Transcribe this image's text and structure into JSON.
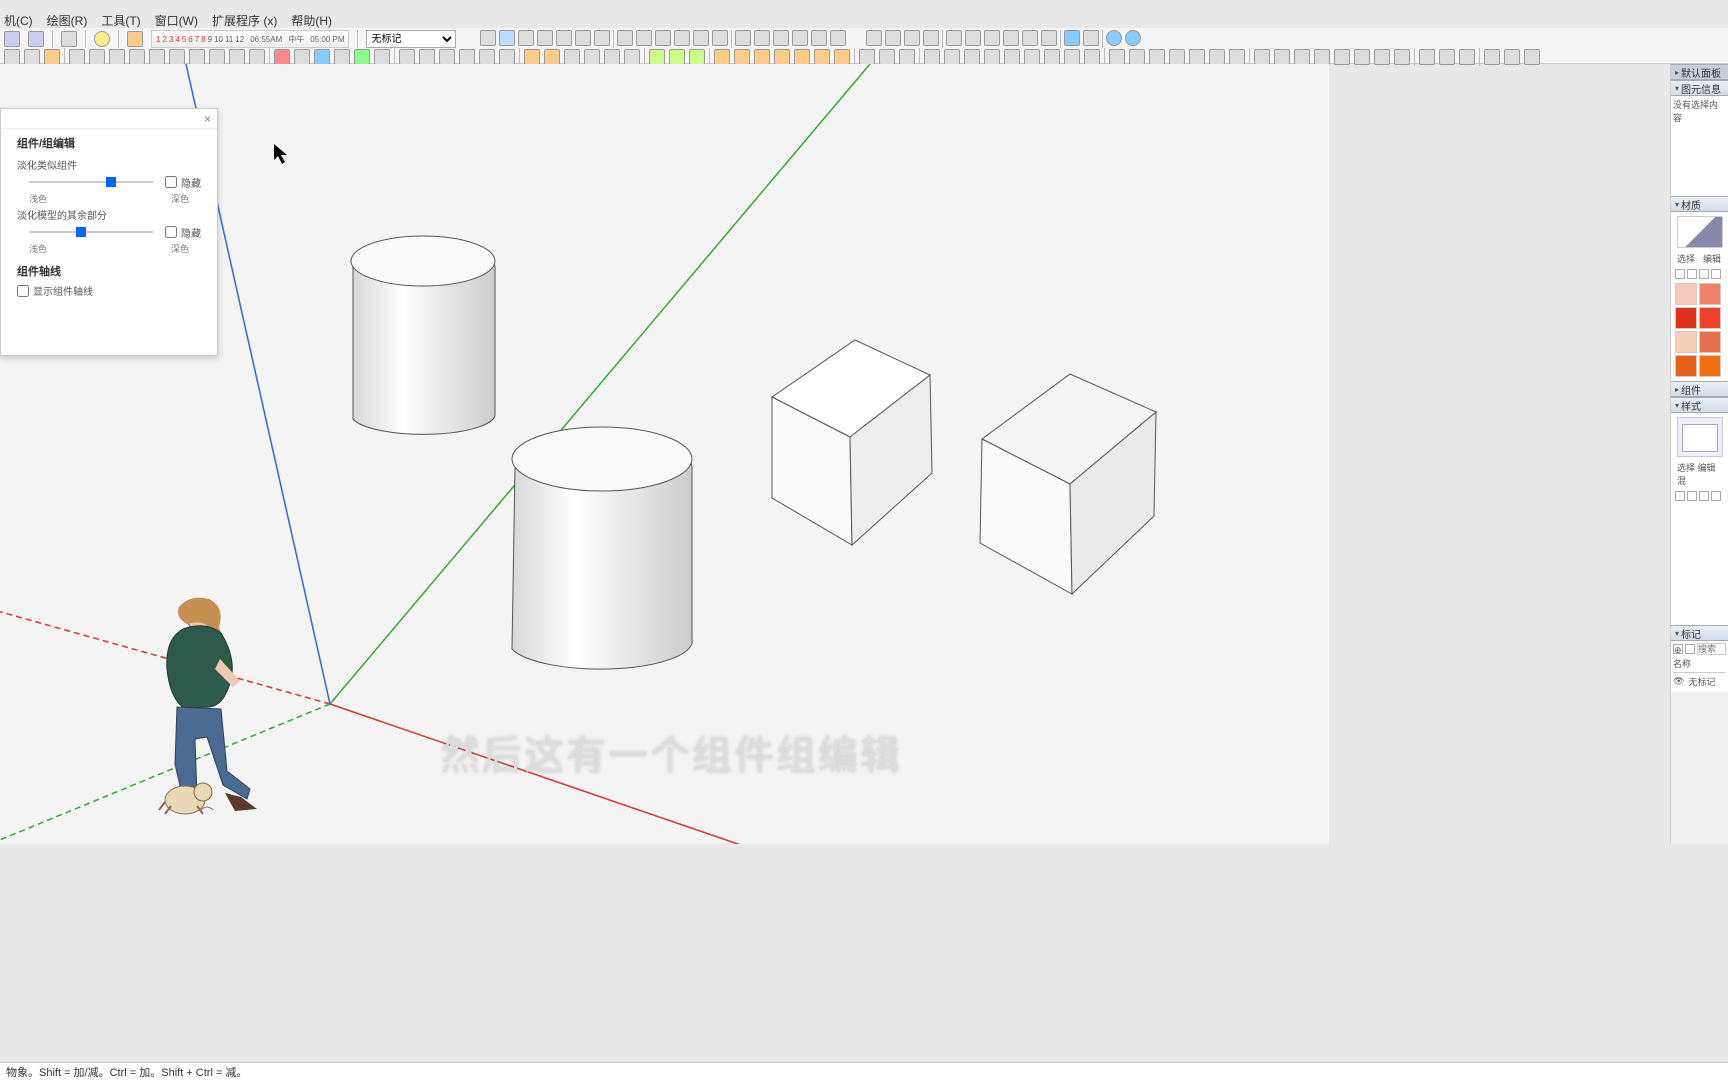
{
  "menu": {
    "items": [
      "机(C)",
      "绘图(R)",
      "工具(T)",
      "窗口(W)",
      "扩展程序 (x)",
      "帮助(H)"
    ]
  },
  "timeline": {
    "numbers": [
      "1",
      "2",
      "3",
      "4",
      "5",
      "6",
      "7",
      "8",
      "9",
      "10",
      "11",
      "12"
    ],
    "red_count": 8,
    "time_left": "06:55AM",
    "mid": "中午",
    "time_right": "05:00 PM"
  },
  "combo": {
    "value": "无标记"
  },
  "panel": {
    "title": "组件/组编辑",
    "section1_title": "淡化类似组件",
    "light_label": "浅色",
    "dark_label": "深色",
    "hide_label": "隐藏",
    "section2_title": "淡化模型的其余部分",
    "axes_title": "组件轴线",
    "axes_chk": "显示组件轴线",
    "slider1_pos": "60%",
    "slider2_pos": "40%"
  },
  "right": {
    "tray_title": "默认面板",
    "p1_title": "图元信息",
    "p1_body": "没有选择内容",
    "p2_title": "材质",
    "tabs": {
      "a": "选择",
      "b": "编辑"
    },
    "palette": [
      "#f8c8bc",
      "#f08068",
      "#e03018",
      "#f04028",
      "#f8d0b8",
      "#e87048",
      "#e86018",
      "#f07010"
    ],
    "p3_title": "组件",
    "p4_title": "样式",
    "tabs2": "选择   编辑   混",
    "p5_title": "标记",
    "tag_search": "搜索",
    "tag_name_hdr": "名称",
    "tag_item": "无标记"
  },
  "caption": "然后这有一个组件组编辑",
  "status": "物象。Shift = 加/减。Ctrl = 加。Shift + Ctrl = 减。"
}
